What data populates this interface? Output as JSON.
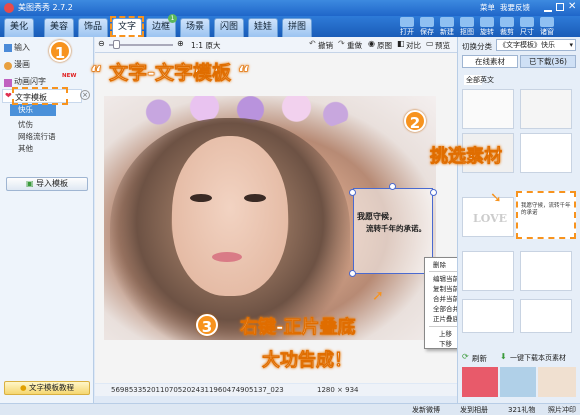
{
  "app": {
    "title": "美图秀秀 2.7.2"
  },
  "window_controls": [
    "菜单",
    "我要反馈"
  ],
  "tabs": [
    "美化",
    "美容",
    "饰品",
    "文字",
    "边框",
    "场景",
    "闪图",
    "娃娃",
    "拼图"
  ],
  "tab_badge": "1",
  "toolbar_buttons": [
    "打开",
    "保存",
    "新建",
    "抠图",
    "旋转",
    "裁剪",
    "尺寸",
    "诸窗"
  ],
  "left_panel": {
    "items": [
      "输入",
      "漫画",
      "动画闪字",
      "文字模板"
    ],
    "new_badge": "NEW",
    "sub_items": [
      "快乐",
      "忧伤",
      "网络流行语",
      "其他"
    ],
    "import_button": "导入模板",
    "tutorial_button": "文字模板教程"
  },
  "edit_toolbar": {
    "zoom_label": "1:1 原大",
    "actions": [
      "撤销",
      "重做",
      "原图",
      "对比",
      "预览"
    ]
  },
  "canvas": {
    "filename": "56985335201107052024311960474905137_023",
    "dimensions": "1280 × 934"
  },
  "right_panel": {
    "category_label": "切换分类",
    "category_value": "《文字模板》快乐",
    "tabs": [
      "在线素材",
      "已下载(36)"
    ],
    "lang_tabs": [
      "全部",
      "英文"
    ],
    "thumb_texts": [
      "LOVE",
      "我愿守候，流转千年的承诺"
    ],
    "refresh": "刷新",
    "download_link": "一键下载本页素材"
  },
  "sticker": {
    "line1": "我愿守候，",
    "line2": "流转千年的承诺。"
  },
  "context_menu": [
    "删除",
    "编辑当前素材",
    "复制当前素材",
    "合并当前素材",
    "全部合并",
    "正片叠底（融合）",
    "上移",
    "下移"
  ],
  "annotations": {
    "step1_caption": "“ 文字-文字模板 “",
    "step2_caption": "挑选素材",
    "step3_line1": "右键-正片叠底",
    "step3_line2": "大功告成！",
    "step_numbers": [
      "1",
      "2",
      "3"
    ]
  },
  "bottom_bar": [
    "发新微博",
    "发到相册",
    "321礼物",
    "照片冲印"
  ],
  "colors": {
    "accent": "#f7931e",
    "title_blue": "#2e7bd8"
  }
}
